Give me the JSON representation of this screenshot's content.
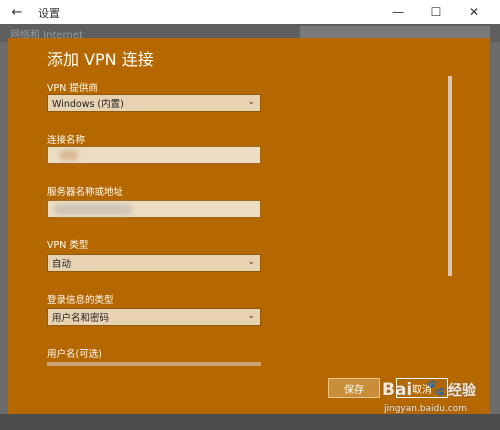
{
  "window": {
    "title": "设置",
    "back_glyph": "←",
    "minimize_glyph": "—",
    "maximize_glyph": "☐",
    "close_glyph": "✕"
  },
  "background": {
    "section_text": "网络和 Internet"
  },
  "dialog": {
    "title": "添加 VPN 连接",
    "fields": {
      "provider": {
        "label": "VPN 提供商",
        "value": "Windows (内置)"
      },
      "connection_name": {
        "label": "连接名称",
        "value": ""
      },
      "server": {
        "label": "服务器名称或地址",
        "value": ""
      },
      "vpn_type": {
        "label": "VPN 类型",
        "value": "自动"
      },
      "signin_type": {
        "label": "登录信息的类型",
        "value": "用户名和密码"
      },
      "username": {
        "label": "用户名(可选)"
      }
    },
    "buttons": {
      "save": "保存",
      "cancel": "取消"
    }
  },
  "watermark": {
    "logo": "Bai",
    "paw": "🐾",
    "text": "经验",
    "url": "jingyan.baidu.com"
  },
  "colors": {
    "dialog_bg": "#b66800",
    "input_bg": "#e7d2b2"
  }
}
